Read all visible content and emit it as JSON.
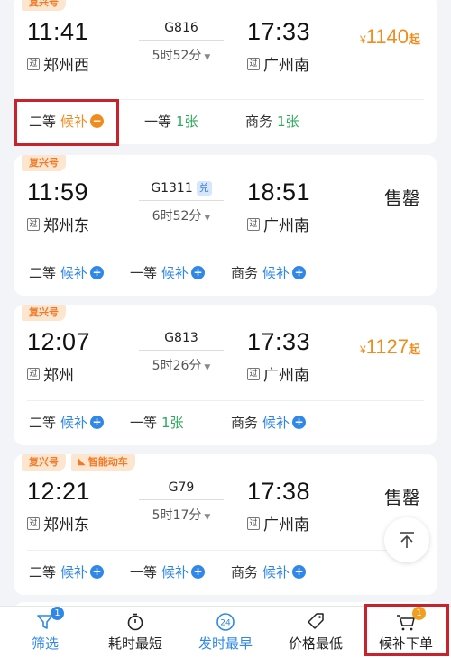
{
  "trains": [
    {
      "tags": [
        "复兴号"
      ],
      "dep_time": "11:41",
      "dep_station": "郑州西",
      "arr_time": "17:33",
      "arr_station": "广州南",
      "train_no": "G816",
      "duration": "5时52分",
      "price_symbol": "¥",
      "price": "1140",
      "price_unit": "起",
      "seats": [
        {
          "class": "二等",
          "status": "候补"
        },
        {
          "class": "一等",
          "status": "1张"
        },
        {
          "class": "商务",
          "status": "1张"
        }
      ]
    },
    {
      "tags": [
        "复兴号"
      ],
      "dep_time": "11:59",
      "dep_station": "郑州东",
      "arr_time": "18:51",
      "arr_station": "广州南",
      "train_no": "G1311",
      "exchange": "兑",
      "duration": "6时52分",
      "sold_out": "售罄",
      "seats": [
        {
          "class": "二等",
          "status": "候补"
        },
        {
          "class": "一等",
          "status": "候补"
        },
        {
          "class": "商务",
          "status": "候补"
        }
      ]
    },
    {
      "tags": [
        "复兴号"
      ],
      "dep_time": "12:07",
      "dep_station": "郑州",
      "arr_time": "17:33",
      "arr_station": "广州南",
      "train_no": "G813",
      "duration": "5时26分",
      "price_symbol": "¥",
      "price": "1127",
      "price_unit": "起",
      "seats": [
        {
          "class": "二等",
          "status": "候补"
        },
        {
          "class": "一等",
          "status": "1张"
        },
        {
          "class": "商务",
          "status": "候补"
        }
      ]
    },
    {
      "tags": [
        "复兴号",
        "智能动车"
      ],
      "dep_time": "12:21",
      "dep_station": "郑州东",
      "arr_time": "17:38",
      "arr_station": "广州南",
      "train_no": "G79",
      "duration": "5时17分",
      "sold_out": "售罄",
      "seats": [
        {
          "class": "二等",
          "status": "候补"
        },
        {
          "class": "一等",
          "status": "候补"
        },
        {
          "class": "商务",
          "status": "候补"
        }
      ]
    }
  ],
  "station_badge": "过",
  "bottom_bar": {
    "filter": {
      "label": "筛选",
      "badge": "1"
    },
    "shortest": {
      "label": "耗时最短"
    },
    "earliest": {
      "label": "发时最早",
      "icon_text": "24"
    },
    "cheapest": {
      "label": "价格最低"
    },
    "waitlist": {
      "label": "候补下单",
      "badge": "1"
    }
  },
  "colors": {
    "accent_blue": "#2f87e8",
    "accent_orange": "#f08c1e",
    "available_green": "#2fa85d",
    "highlight_red": "#c8232c"
  }
}
